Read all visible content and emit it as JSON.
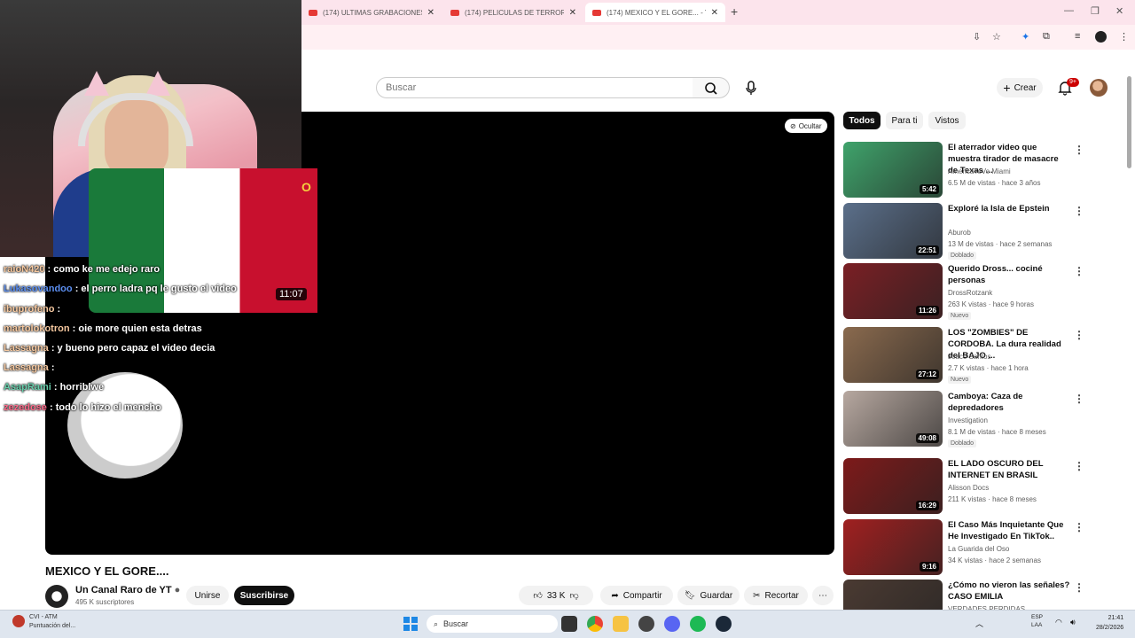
{
  "browser": {
    "tabs": [
      {
        "title": "(174) ULTIMAS GRABACIONES"
      },
      {
        "title": "(174) PELICULAS DE TERROR Q"
      },
      {
        "title": "(174) MEXICO Y EL GORE... - Yo"
      }
    ]
  },
  "header": {
    "search_placeholder": "Buscar",
    "create_label": "Crear",
    "notif_count": "9+"
  },
  "player": {
    "hide_label": "Ocultar",
    "thumb_duration": "11:07"
  },
  "chat": [
    {
      "user": "raioN420",
      "text": ": como ke me edejo raro"
    },
    {
      "user": "Lukasovandoo",
      "text": ": el perro ladra pq le gusto el video"
    },
    {
      "user": "ibuprofeno",
      "text": ":"
    },
    {
      "user": "martolokotron",
      "text": ": oie more quien esta detras"
    },
    {
      "user": "Lassagna",
      "text": ": y bueno pero capaz el video decia"
    },
    {
      "user": "Lassagna",
      "text": ":"
    },
    {
      "user": "AsapRami",
      "text": ": horriblwe"
    },
    {
      "user": "zezedose",
      "text": ": todo lo hizo el mencho"
    }
  ],
  "video": {
    "title": "MEXICO Y EL GORE....",
    "channel": "Un Canal Raro de YT",
    "subscribers": "495 K suscriptores",
    "join_label": "Unirse",
    "subscribe_label": "Suscribirse",
    "likes": "33 K",
    "share_label": "Compartir",
    "save_label": "Guardar",
    "clip_label": "Recortar"
  },
  "filters": [
    "Todos",
    "Para ti",
    "Vistos"
  ],
  "recommendations": [
    {
      "title": "El aterrador video que muestra tirador de masacre de Texas ...",
      "channel": "AmericaTeVe Miami",
      "views": "6.5 M de vistas · hace 3 años",
      "badge": "",
      "duration": "5:42",
      "thumb_color": "#3fa36b"
    },
    {
      "title": "Exploré la Isla de Epstein",
      "channel": "Aburob",
      "views": "13 M de vistas · hace 2 semanas",
      "badge": "Doblado",
      "duration": "22:51",
      "thumb_color": "#5b6f8a"
    },
    {
      "title": "Querido Dross... cociné personas",
      "channel": "DrossRotzank",
      "views": "263 K vistas · hace 9 horas",
      "badge": "Nuevo",
      "duration": "11:26",
      "thumb_color": "#7a1f24"
    },
    {
      "title": "LOS \"ZOMBIES\" DE CORDOBA. La dura realidad del BAJO ...",
      "channel": "Joaco Santos",
      "views": "2.7 K vistas · hace 1 hora",
      "badge": "Nuevo",
      "duration": "27:12",
      "thumb_color": "#8a6a4e"
    },
    {
      "title": "Camboya: Caza de depredadores",
      "channel": "Investigation",
      "views": "8.1 M de vistas · hace 8 meses",
      "badge": "Doblado",
      "duration": "49:08",
      "thumb_color": "#b7a8a0"
    },
    {
      "title": "EL LADO OSCURO DEL INTERNET EN BRASIL",
      "channel": "Alisson Docs",
      "views": "211 K vistas · hace 8 meses",
      "badge": "",
      "duration": "16:29",
      "thumb_color": "#7d1a1a"
    },
    {
      "title": "El Caso Más Inquietante Que He Investigado En TikTok..",
      "channel": "La Guarida del Oso",
      "views": "34 K vistas · hace 2 semanas",
      "badge": "",
      "duration": "9:16",
      "thumb_color": "#a02020"
    },
    {
      "title": "¿Cómo no vieron las señales? CASO EMILIA",
      "channel": "VERDADES PERDIDAS",
      "views": "",
      "badge": "",
      "duration": "",
      "thumb_color": "#4a3a32"
    }
  ],
  "taskbar": {
    "weather_title": "CVI - ATM",
    "weather_sub": "Puntuación del...",
    "search_label": "Buscar",
    "lang1": "ESP",
    "lang2": "LAA",
    "time": "21:41",
    "date": "28/2/2026"
  }
}
